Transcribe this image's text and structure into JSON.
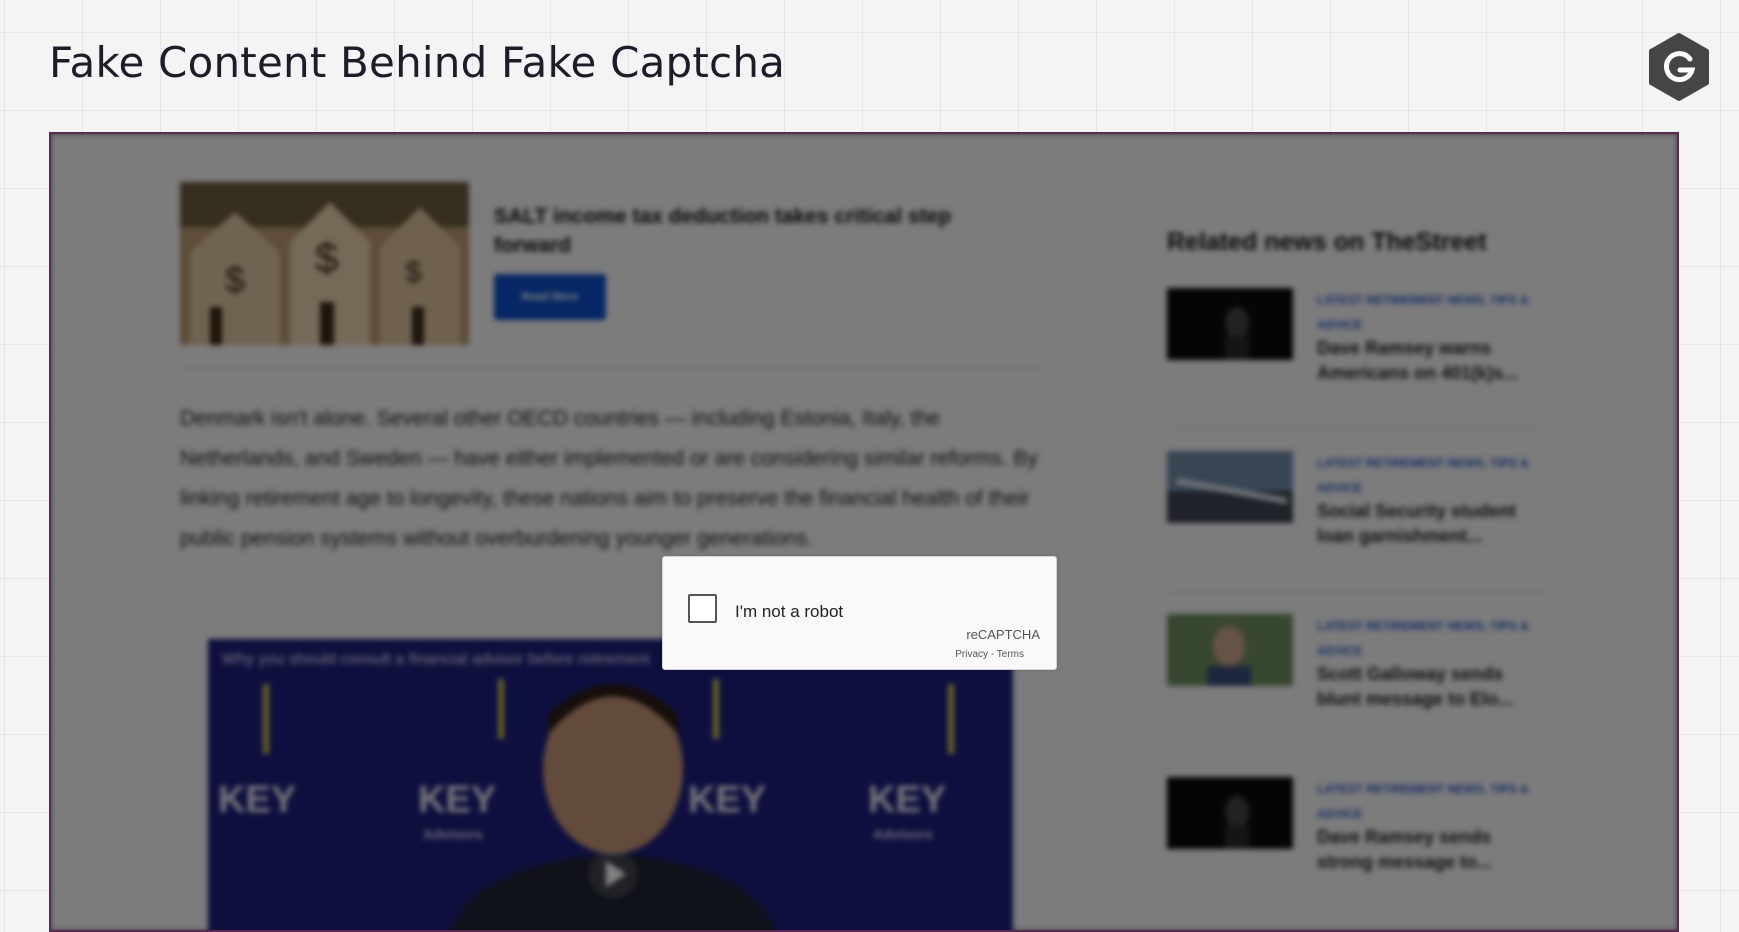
{
  "page_title": "Fake Content Behind Fake Captcha",
  "brand_logo_icon": "hexagon-g-logo-icon",
  "blurred_page": {
    "promo": {
      "title": "SALT income tax deduction takes critical step forward",
      "button_label": "Read More"
    },
    "article_text": "Denmark isn't alone. Several other OECD countries — including Estonia, Italy, the Netherlands, and Sweden — have either implemented or are considering similar reforms. By linking retirement age to longevity, these nations aim to preserve the financial health of their public pension systems without overburdening younger generations.",
    "video": {
      "caption": "Why you should consult a financial advisor before retirement",
      "brand_text": "KEY",
      "brand_sub": "Advisors",
      "play_icon": "play-icon"
    },
    "related": {
      "heading": "Related news on TheStreet",
      "items": [
        {
          "category": "LATEST RETIREMENT NEWS, TIPS & ADVICE",
          "title": "Dave Ramsey warns Americans on 401(k)s..."
        },
        {
          "category": "LATEST RETIREMENT NEWS, TIPS & ADVICE",
          "title": "Social Security student loan garnishment..."
        },
        {
          "category": "LATEST RETIREMENT NEWS, TIPS & ADVICE",
          "title": "Scott Galloway sends blunt message to Elo..."
        },
        {
          "category": "LATEST RETIREMENT NEWS, TIPS & ADVICE",
          "title": "Dave Ramsey sends strong message to..."
        }
      ]
    }
  },
  "captcha": {
    "label": "I'm not a robot",
    "brand": "reCAPTCHA",
    "privacy": "Privacy",
    "separator": "-",
    "terms": "Terms"
  }
}
